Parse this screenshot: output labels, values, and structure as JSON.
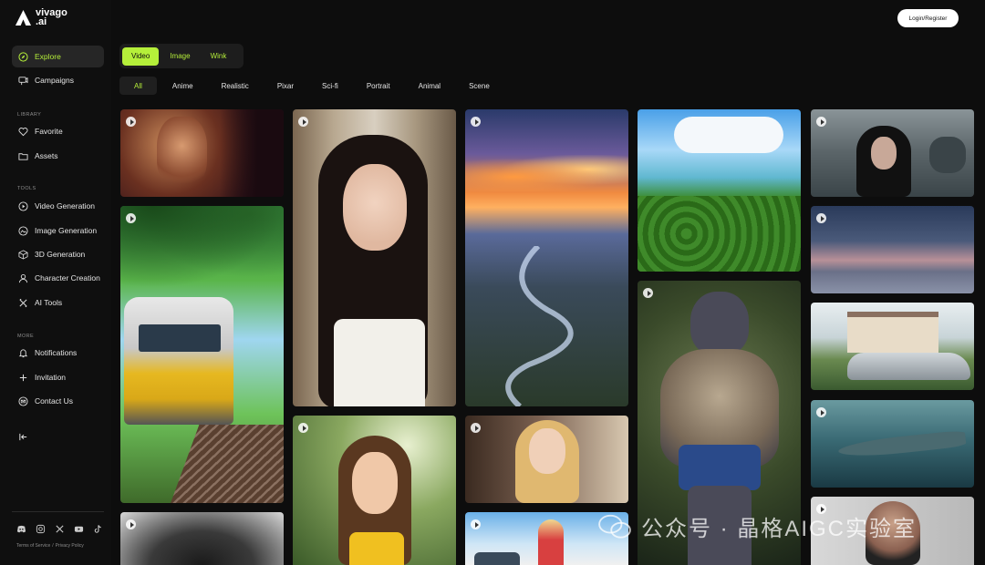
{
  "brand": {
    "name_line1": "vivago",
    "name_line2": ".ai"
  },
  "sidebar": {
    "main": [
      {
        "label": "Explore",
        "icon": "compass-icon"
      },
      {
        "label": "Campaigns",
        "icon": "campaign-icon"
      }
    ],
    "library_label": "LIBRARY",
    "library": [
      {
        "label": "Favorite",
        "icon": "heart-icon"
      },
      {
        "label": "Assets",
        "icon": "folder-icon"
      }
    ],
    "tools_label": "TOOLS",
    "tools": [
      {
        "label": "Video Generation",
        "icon": "play-circle-icon"
      },
      {
        "label": "Image Generation",
        "icon": "image-icon"
      },
      {
        "label": "3D Generation",
        "icon": "cube-icon"
      },
      {
        "label": "Character Creation",
        "icon": "person-icon"
      },
      {
        "label": "AI Tools",
        "icon": "tools-icon"
      }
    ],
    "more_label": "MORE",
    "more": [
      {
        "label": "Notifications",
        "icon": "bell-icon"
      },
      {
        "label": "Invitation",
        "icon": "plus-icon"
      },
      {
        "label": "Contact Us",
        "icon": "mail-icon"
      }
    ],
    "footer": {
      "terms": "Terms of Service",
      "sep": "/",
      "privacy": "Privacy Policy"
    },
    "socials": [
      "discord-icon",
      "instagram-icon",
      "x-icon",
      "youtube-icon",
      "tiktok-icon"
    ]
  },
  "header": {
    "login_label": "Login/Register"
  },
  "type_tabs": [
    "Video",
    "Image",
    "Wink"
  ],
  "categories": [
    "All",
    "Anime",
    "Realistic",
    "Pixar",
    "Sci-fi",
    "Portrait",
    "Animal",
    "Scene"
  ],
  "colors": {
    "accent": "#b5ef3a",
    "background": "#0d0d0d"
  },
  "watermark": {
    "text": "公众号 · 晶格AIGC实验室"
  }
}
